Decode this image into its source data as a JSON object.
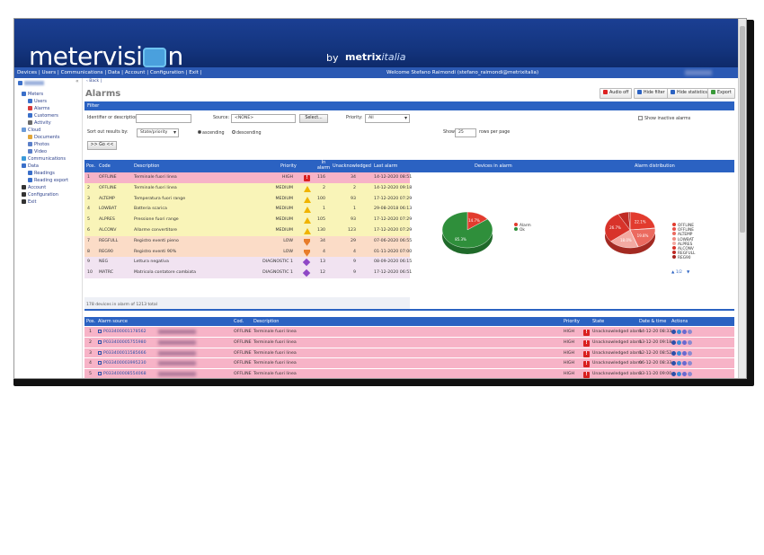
{
  "app": {
    "logo_text_before": "metervisi",
    "logo_text_after": "n",
    "by": "by",
    "partner_main": "metrix",
    "partner_sub": "italia"
  },
  "nav": {
    "links": "Devices | Users | Communications | Data | Account | Configuration | Exit |",
    "welcome": "Welcome Stefano Raimondi (stefano_raimondi@metrixitalia)"
  },
  "sidebar": {
    "items": [
      {
        "label": "Meters",
        "color": "#3a6fc9"
      },
      {
        "label": "Users",
        "color": "#3a6fc9"
      },
      {
        "label": "Alarms",
        "color": "#d83a3a"
      },
      {
        "label": "Customers",
        "color": "#3a6fc9"
      },
      {
        "label": "Activity",
        "color": "#6a6a6a"
      },
      {
        "label": "Cloud",
        "color": "#6a9ad8"
      },
      {
        "label": "Documents",
        "color": "#e1a63a"
      },
      {
        "label": "Photos",
        "color": "#5a7fc9"
      },
      {
        "label": "Video",
        "color": "#5a7fc9"
      },
      {
        "label": "Communications",
        "color": "#3a9ad8"
      },
      {
        "label": "Data",
        "color": "#3a6fc9"
      },
      {
        "label": "Readings",
        "color": "#3a6fc9"
      },
      {
        "label": "Reading export",
        "color": "#3a6fc9"
      },
      {
        "label": "Account",
        "color": "#333"
      },
      {
        "label": "Configuration",
        "color": "#333"
      },
      {
        "label": "Exit",
        "color": "#333"
      }
    ]
  },
  "page": {
    "back": "‹ Back |",
    "title": "Alarms",
    "buttons": {
      "audio_off": "Audio off",
      "hide_filter": "Hide filter",
      "hide_statistics": "Hide statistics",
      "export": "Export"
    }
  },
  "filter": {
    "header": "Filter",
    "identifier_label": "Identifier or description:",
    "identifier_value": "",
    "source_label": "Source:",
    "source_value": "<NONE>",
    "select_button": "Select...",
    "priority_label": "Priority:",
    "priority_value": "All",
    "show_inactive": "Show inactive alarms",
    "sort_label": "Sort out results by:",
    "sort_value": "State/priority",
    "ascending": "ascending",
    "descending": "descending",
    "show_label": "Show",
    "show_value": "25",
    "rows_label": "rows per page",
    "go_button": ">> Go <<"
  },
  "alarm_table": {
    "headers": {
      "pos": "Pos.",
      "code": "Code",
      "description": "Description",
      "priority": "Priority",
      "in_alarm": "In alarm",
      "unack": "Unacknowledged",
      "last": "Last alarm",
      "devices": "Devices in alarm",
      "distribution": "Alarm distribution"
    },
    "rows": [
      {
        "pos": "1",
        "code": "OFFLINE",
        "desc": "Terminale fuori linea",
        "prio": "HIGH",
        "icon": "high",
        "in": "116",
        "unack": "34",
        "last": "14-12-2020 08:51",
        "bg": "#f7b3c7"
      },
      {
        "pos": "2",
        "code": "OFFLINE",
        "desc": "Terminale fuori linea",
        "prio": "MEDIUM",
        "icon": "medium",
        "in": "2",
        "unack": "2",
        "last": "14-12-2020 09:18",
        "bg": "#f9f4b8"
      },
      {
        "pos": "3",
        "code": "ALTEMP",
        "desc": "Temperatura fuori range",
        "prio": "MEDIUM",
        "icon": "medium",
        "in": "100",
        "unack": "93",
        "last": "17-12-2020 07:29",
        "bg": "#f9f4b8"
      },
      {
        "pos": "4",
        "code": "LOWBAT",
        "desc": "Batteria scarica",
        "prio": "MEDIUM",
        "icon": "medium",
        "in": "1",
        "unack": "1",
        "last": "29-08-2018 06:13",
        "bg": "#f9f4b8"
      },
      {
        "pos": "5",
        "code": "ALPRES",
        "desc": "Pressione fuori range",
        "prio": "MEDIUM",
        "icon": "medium",
        "in": "105",
        "unack": "93",
        "last": "17-12-2020 07:29",
        "bg": "#f9f4b8"
      },
      {
        "pos": "6",
        "code": "ALCONV",
        "desc": "Allarme convertitore",
        "prio": "MEDIUM",
        "icon": "medium",
        "in": "130",
        "unack": "123",
        "last": "17-12-2020 07:29",
        "bg": "#f9f4b8"
      },
      {
        "pos": "7",
        "code": "REGFULL",
        "desc": "Registro eventi pieno",
        "prio": "LOW",
        "icon": "low",
        "in": "34",
        "unack": "29",
        "last": "07-06-2020 06:55",
        "bg": "#fbdcc7"
      },
      {
        "pos": "8",
        "code": "REG90",
        "desc": "Registro eventi 90%",
        "prio": "LOW",
        "icon": "low",
        "in": "4",
        "unack": "4",
        "last": "01-11-2020 07:00",
        "bg": "#fbdcc7"
      },
      {
        "pos": "9",
        "code": "NEG",
        "desc": "Lettura negativa",
        "prio": "DIAGNOSTIC 1",
        "icon": "diag",
        "in": "13",
        "unack": "9",
        "last": "08-09-2020 06:15",
        "bg": "#f1e3f1"
      },
      {
        "pos": "10",
        "code": "MATRC",
        "desc": "Matricola contatore cambiata",
        "prio": "DIAGNOSTIC 1",
        "icon": "diag",
        "in": "12",
        "unack": "9",
        "last": "17-12-2020 06:51",
        "bg": "#f1e3f1"
      }
    ],
    "summary": "178 devices in alarm of 1213 total"
  },
  "chart_data": [
    {
      "type": "pie",
      "title": "Devices in alarm",
      "slices": [
        {
          "label": "Alarm",
          "value": 14.7,
          "color": "#e23b2e"
        },
        {
          "label": "Ok",
          "value": 85.3,
          "color": "#2f8f3b"
        }
      ],
      "legend_position": "right"
    },
    {
      "type": "pie",
      "title": "Alarm distribution",
      "slices": [
        {
          "label": "OFFLINE",
          "value": 22.1,
          "color": "#e23b2e"
        },
        {
          "label": "OFFLINE",
          "value": 0.5,
          "color": "#e8504a"
        },
        {
          "label": "ALTEMP",
          "value": 19.8,
          "color": "#eb6a5f"
        },
        {
          "label": "LOWBAT",
          "value": 0.3,
          "color": "#ef8a80"
        },
        {
          "label": "ALPRES",
          "value": 18.0,
          "color": "#f3aaa2"
        },
        {
          "label": "ALCONV",
          "value": 26.7,
          "color": "#d8332a"
        },
        {
          "label": "REGFULL",
          "value": 6.5,
          "color": "#c02a24"
        },
        {
          "label": "REG90",
          "value": 1.0,
          "color": "#a62520"
        }
      ],
      "labels_shown": [
        "22.1%",
        "19.8%",
        "18.0%",
        "26.7%"
      ],
      "legend_position": "right",
      "legend_pager": "1/2"
    }
  ],
  "source_table": {
    "headers": {
      "pos": "Pos.",
      "source": "Alarm source",
      "cod": "Cod.",
      "description": "Description",
      "priority": "Priority",
      "state": "State",
      "datetime": "Date & time",
      "actions": "Actions"
    },
    "rows": [
      {
        "pos": "1",
        "id": "P033400001178562",
        "cod": "OFFLINE",
        "desc": "Terminale fuori linea",
        "prio": "HIGH",
        "state": "Unacknowledged alarm",
        "dt": "14-12-20 08:33"
      },
      {
        "pos": "2",
        "id": "P033400005755980",
        "cod": "OFFLINE",
        "desc": "Terminale fuori linea",
        "prio": "HIGH",
        "state": "Unacknowledged alarm",
        "dt": "13-12-20 09:18"
      },
      {
        "pos": "3",
        "id": "P033400011585666",
        "cod": "OFFLINE",
        "desc": "Terminale fuori linea",
        "prio": "HIGH",
        "state": "Unacknowledged alarm",
        "dt": "12-12-20 08:52"
      },
      {
        "pos": "4",
        "id": "P033400003995230",
        "cod": "OFFLINE",
        "desc": "Terminale fuori linea",
        "prio": "HIGH",
        "state": "Unacknowledged alarm",
        "dt": "06-12-20 08:33"
      },
      {
        "pos": "5",
        "id": "P033400008554068",
        "cod": "OFFLINE",
        "desc": "Terminale fuori linea",
        "prio": "HIGH",
        "state": "Unacknowledged alarm",
        "dt": "23-11-20 09:00"
      },
      {
        "pos": "6",
        "id": "P033400011835857",
        "cod": "OFFLINE",
        "desc": "Terminale fuori linea",
        "prio": "HIGH",
        "state": "Unacknowledged alarm",
        "dt": "12-11-20 08:04"
      }
    ]
  }
}
